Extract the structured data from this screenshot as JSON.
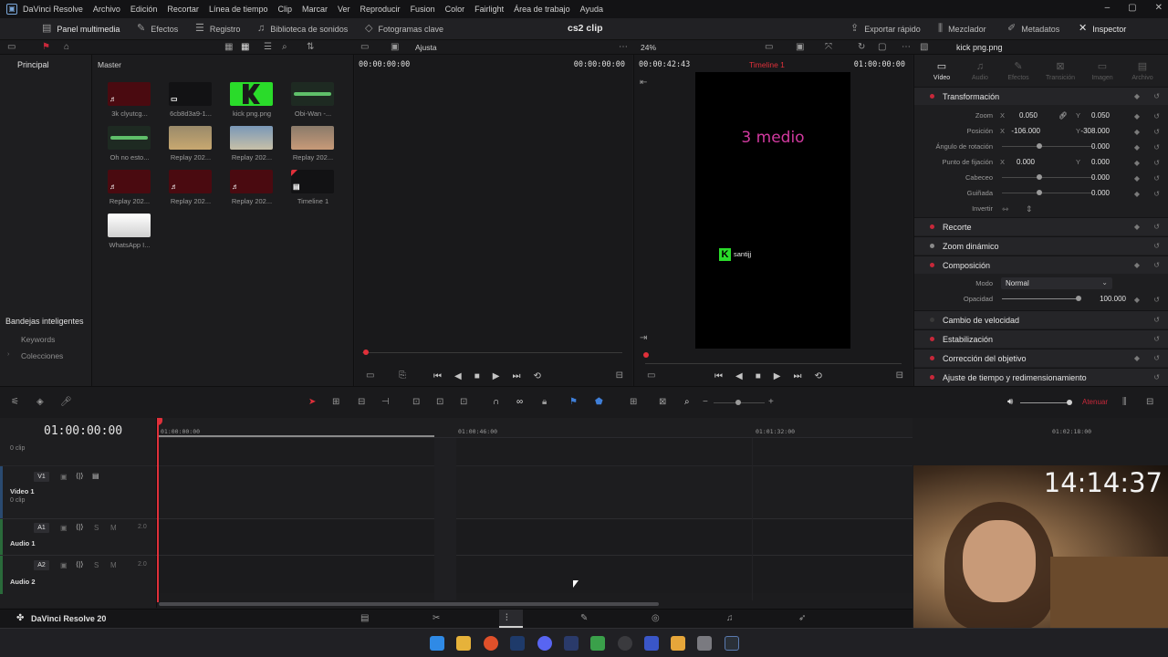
{
  "menubar": {
    "app": "DaVinci Resolve",
    "items": [
      "Archivo",
      "Edición",
      "Recortar",
      "Línea de tiempo",
      "Clip",
      "Marcar",
      "Ver",
      "Reproducir",
      "Fusion",
      "Color",
      "Fairlight",
      "Área de trabajo",
      "Ayuda"
    ]
  },
  "toolbar": {
    "media_pool": "Panel multimedia",
    "effects": "Efectos",
    "edit_index": "Registro",
    "sound_library": "Biblioteca de sonidos",
    "keyframes": "Fotogramas clave",
    "project_title": "cs2 clip",
    "quick_export": "Exportar rápido",
    "mixer": "Mezclador",
    "metadata": "Metadatos",
    "inspector": "Inspector"
  },
  "subbar": {
    "fit": "Ajusta",
    "zoom": "24%",
    "clip_name": "kick png.png"
  },
  "leftpanel": {
    "principal": "Principal",
    "smart_bins": "Bandejas inteligentes",
    "keywords": "Keywords",
    "collections": "Colecciones"
  },
  "mediapool": {
    "master": "Master",
    "clips": [
      {
        "name": "3k clyutcg...",
        "kind": "audio-red"
      },
      {
        "name": "6cb8d3a9-1...",
        "kind": "video-dark"
      },
      {
        "name": "kick png.png",
        "kind": "image-green"
      },
      {
        "name": "Obi-Wan -...",
        "kind": "wave"
      },
      {
        "name": "Oh no esto...",
        "kind": "wave"
      },
      {
        "name": "Replay 202...",
        "kind": "game1"
      },
      {
        "name": "Replay 202...",
        "kind": "game2"
      },
      {
        "name": "Replay 202...",
        "kind": "game3"
      },
      {
        "name": "Replay 202...",
        "kind": "audio-red"
      },
      {
        "name": "Replay 202...",
        "kind": "audio-red"
      },
      {
        "name": "Replay 202...",
        "kind": "audio-red"
      },
      {
        "name": "Timeline 1",
        "kind": "timeline"
      },
      {
        "name": "WhatsApp I...",
        "kind": "whatsapp"
      }
    ]
  },
  "source_viewer": {
    "tc_left": "00:00:00:00",
    "tc_right": "00:00:00:00"
  },
  "program_viewer": {
    "duration": "00:00:42:43",
    "timeline_name": "Timeline 1",
    "tc": "01:00:00:00",
    "overlay_text": "3 medio",
    "overlay_text_color": "#d23aa0",
    "logo_letter": "K",
    "logo_text": "santijj"
  },
  "inspector": {
    "tabs": [
      "Vídeo",
      "Audio",
      "Efectos",
      "Transición",
      "Imagen",
      "Archivo"
    ],
    "sections": {
      "transform": "Transformación",
      "crop": "Recorte",
      "dynamic_zoom": "Zoom dinámico",
      "composite": "Composición",
      "speed_change": "Cambio de velocidad",
      "stabilization": "Estabilización",
      "lens_correction": "Corrección del objetivo",
      "retime_scaling": "Ajuste de tiempo y redimensionamiento"
    },
    "props": {
      "zoom_label": "Zoom",
      "zoom_x": "0.050",
      "zoom_y": "0.050",
      "position_label": "Posición",
      "pos_x": "-106.000",
      "pos_y": "-308.000",
      "rotation_label": "Ángulo de rotación",
      "rotation": "0.000",
      "anchor_label": "Punto de fijación",
      "anchor_x": "0.000",
      "anchor_y": "0.000",
      "pitch_label": "Cabeceo",
      "pitch": "0.000",
      "yaw_label": "Guiñada",
      "yaw": "0.000",
      "flip_label": "Invertir",
      "mode_label": "Modo",
      "mode": "Normal",
      "opacity_label": "Opacidad",
      "opacity": "100.000",
      "axis_x": "X",
      "axis_y": "Y"
    }
  },
  "timeline": {
    "timecode": "01:00:00:00",
    "ruler": [
      "01:00:00:00",
      "01:00:46:00",
      "01:01:32:00",
      "01:02:18:00"
    ],
    "audio_level_label": "Atenuar",
    "tracks": {
      "top_sub": "0 clip",
      "v1_tag": "V1",
      "v1_name": "Video 1",
      "v1_sub": "0 clip",
      "a1_tag": "A1",
      "a1_name": "Audio 1",
      "a1_ch": "2.0",
      "a2_tag": "A2",
      "a2_name": "Audio 2",
      "a2_ch": "2.0",
      "s": "S",
      "m": "M"
    }
  },
  "pagebar": {
    "app_name": "DaVinci Resolve 20"
  },
  "webcam": {
    "clock": "14:14:37"
  },
  "colors": {
    "accent_red": "#c8283a",
    "accent_blue": "#3f7fd8",
    "playhead": "#e0303a"
  }
}
